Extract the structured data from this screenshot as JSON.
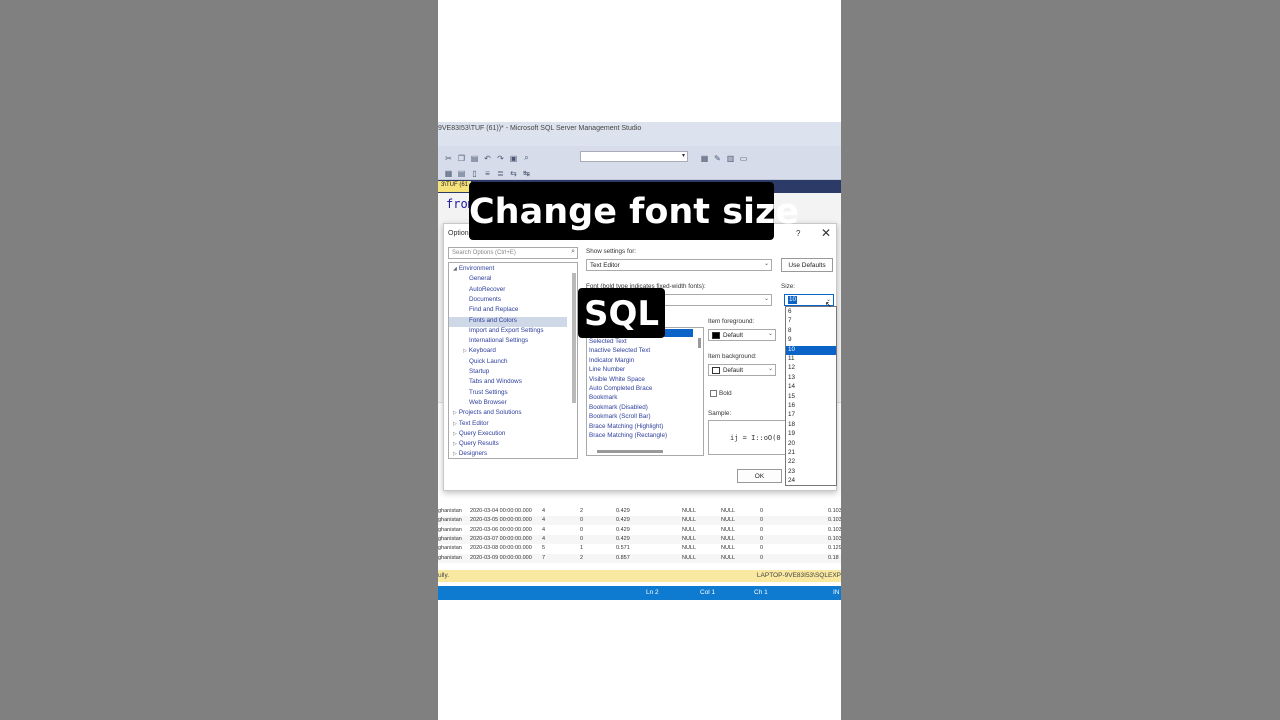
{
  "window": {
    "title": "9VE83I53\\TUF (61))* - Microsoft SQL Server Management Studio"
  },
  "editor": {
    "tab_label": "3\\TUF (61",
    "code_text": "from"
  },
  "dialog": {
    "title": "Options",
    "help": "?",
    "close": "✕",
    "search_placeholder": "Search Options (Ctrl+E)",
    "tree": [
      {
        "label": "Environment",
        "level": 0,
        "expander": "◢"
      },
      {
        "label": "General",
        "level": 2,
        "expander": ""
      },
      {
        "label": "AutoRecover",
        "level": 2,
        "expander": ""
      },
      {
        "label": "Documents",
        "level": 2,
        "expander": ""
      },
      {
        "label": "Find and Replace",
        "level": 2,
        "expander": ""
      },
      {
        "label": "Fonts and Colors",
        "level": 2,
        "expander": "",
        "selected": true
      },
      {
        "label": "Import and Export Settings",
        "level": 2,
        "expander": ""
      },
      {
        "label": "International Settings",
        "level": 2,
        "expander": ""
      },
      {
        "label": "Keyboard",
        "level": 1,
        "expander": "▷"
      },
      {
        "label": "Quick Launch",
        "level": 2,
        "expander": ""
      },
      {
        "label": "Startup",
        "level": 2,
        "expander": ""
      },
      {
        "label": "Tabs and Windows",
        "level": 2,
        "expander": ""
      },
      {
        "label": "Trust Settings",
        "level": 2,
        "expander": ""
      },
      {
        "label": "Web Browser",
        "level": 2,
        "expander": ""
      },
      {
        "label": "Projects and Solutions",
        "level": 0,
        "expander": "▷"
      },
      {
        "label": "Text Editor",
        "level": 0,
        "expander": "▷"
      },
      {
        "label": "Query Execution",
        "level": 0,
        "expander": "▷"
      },
      {
        "label": "Query Results",
        "level": 0,
        "expander": "▷"
      },
      {
        "label": "Designers",
        "level": 0,
        "expander": "▷"
      }
    ],
    "show_settings_label": "Show settings for:",
    "show_settings_value": "Text Editor",
    "use_defaults_label": "Use Defaults",
    "font_label": "Font (bold type indicates fixed-width fonts):",
    "size_label": "Size:",
    "size_value": "10",
    "display_items": [
      "Selected Text",
      "Inactive Selected Text",
      "Indicator Margin",
      "Line Number",
      "Visible White Space",
      "Auto Completed Brace",
      "Bookmark",
      "Bookmark (Disabled)",
      "Bookmark (Scroll Bar)",
      "Brace Matching (Highlight)",
      "Brace Matching (Rectangle)"
    ],
    "item_foreground_label": "Item foreground:",
    "item_foreground_value": "Default",
    "item_background_label": "Item background:",
    "item_background_value": "Default",
    "bold_label": "Bold",
    "sample_label": "Sample:",
    "sample_text": "ij = I::oO(0",
    "ok_label": "OK",
    "size_options": [
      "6",
      "7",
      "8",
      "9",
      "10",
      "11",
      "12",
      "13",
      "14",
      "15",
      "16",
      "17",
      "18",
      "19",
      "20",
      "21",
      "22",
      "23",
      "24"
    ],
    "size_selected": "10"
  },
  "results": {
    "rows": [
      [
        "ghanistan",
        "2020-03-04 00:00:00.000",
        "4",
        "2",
        "0.429",
        "NULL",
        "NULL",
        "0",
        "0.103"
      ],
      [
        "ghanistan",
        "2020-03-05 00:00:00.000",
        "4",
        "0",
        "0.429",
        "NULL",
        "NULL",
        "0",
        "0.103"
      ],
      [
        "ghanistan",
        "2020-03-06 00:00:00.000",
        "4",
        "0",
        "0.429",
        "NULL",
        "NULL",
        "0",
        "0.103"
      ],
      [
        "ghanistan",
        "2020-03-07 00:00:00.000",
        "4",
        "0",
        "0.429",
        "NULL",
        "NULL",
        "0",
        "0.103"
      ],
      [
        "ghanistan",
        "2020-03-08 00:00:00.000",
        "5",
        "1",
        "0.571",
        "NULL",
        "NULL",
        "0",
        "0.129"
      ],
      [
        "ghanistan",
        "2020-03-09 00:00:00.000",
        "7",
        "2",
        "0.857",
        "NULL",
        "NULL",
        "0",
        "0.18"
      ]
    ]
  },
  "status": {
    "left_text": "ully.",
    "server_text": "LAPTOP-9VE83I53\\SQLEXP",
    "ln": "Ln 2",
    "col": "Col 1",
    "ch": "Ch 1",
    "ins": "IN"
  },
  "captions": {
    "top": "Change font size",
    "bottom": "SQL"
  },
  "colors": {
    "accent_blue": "#0a64c8",
    "status_blue": "#0e7ad0",
    "status_yellow": "#f8e8a0",
    "tree_text": "#2c3e9c"
  }
}
